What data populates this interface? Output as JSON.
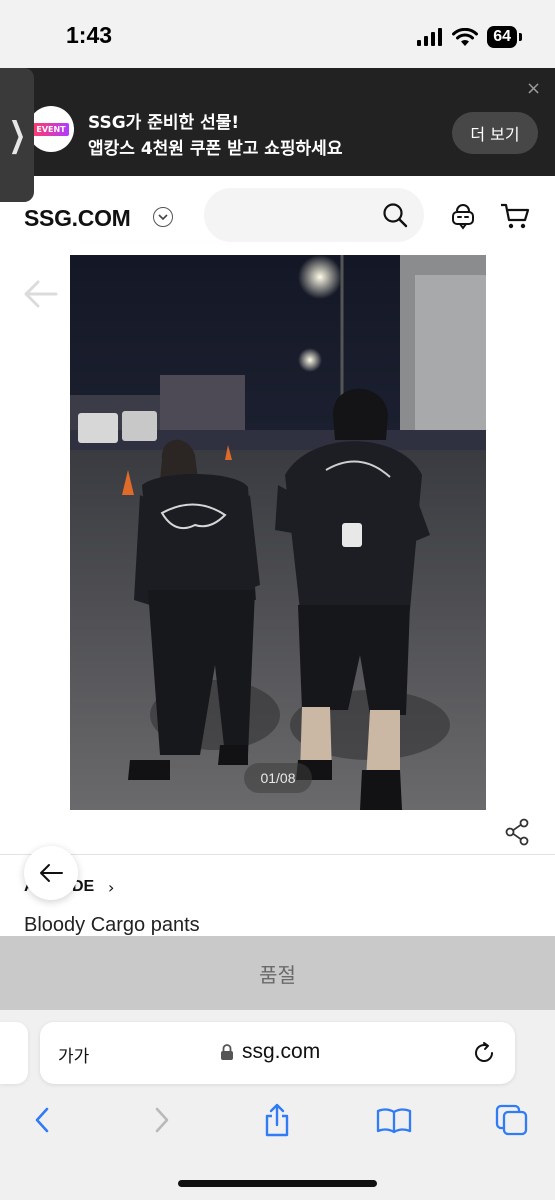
{
  "status_bar": {
    "time": "1:43",
    "battery": "64"
  },
  "event_banner": {
    "logo_text": "EVENT",
    "title": "SSG가 준비한 선물!",
    "subtitle": "앱캉스 4천원 쿠폰 받고 쇼핑하세요",
    "more_button": "더 보기",
    "close": "×",
    "side_tab": "❯"
  },
  "header": {
    "logo": "SSG.COM",
    "search_placeholder": ""
  },
  "gallery": {
    "counter": "01/08"
  },
  "product": {
    "brand": "AWENDE",
    "brand_chevron": "›",
    "name": "Bloody Cargo pants",
    "status_button": "품절"
  },
  "browser": {
    "text_size": "가가",
    "url": "ssg.com"
  },
  "colors": {
    "banner_bg": "#222222",
    "soldout_bg": "#c9c9c9",
    "safari_accent": "#2f7cf6"
  }
}
